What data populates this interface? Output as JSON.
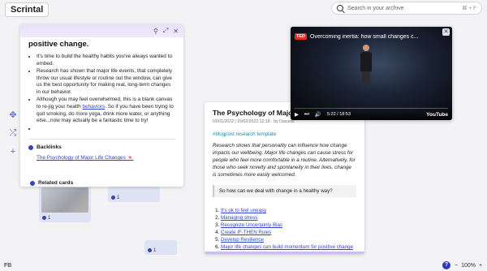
{
  "app": {
    "logo": "Scrintal"
  },
  "search": {
    "placeholder": "Search in your archive",
    "shortcut": "⌘ + F"
  },
  "toolbar_left": {
    "icons": [
      "move-icon",
      "shuffle-icon",
      "plus-icon"
    ]
  },
  "left_card": {
    "title": "positive change.",
    "bullets": [
      "It's time to build the healthy habits you've always wanted to embed.",
      "Research has shown that major life events, that completely throw our usual lifestyle or routine out the window, can give us the best opportunity for making real, long-term changes in our behavior.",
      "Although you may feel overwhelmed, this is a blank canvas to re-jig your health behaviors. So if you have been trying to quit smoking, do more yoga, drink more water, or anything else...now may actually be a fantastic time to try!"
    ],
    "bullet3_parts": {
      "pre": "Although you may feel overwhelmed, this is a blank canvas to re-jig your health ",
      "link": "behaviors",
      "post": ". So if you have been trying to quit smoking, do more yoga, drink more water, or anything else...now may actually be a fantastic time to try!"
    },
    "backlinks_label": "Backlinks",
    "backlink": "The Psychology of Major Life Changes 🍬",
    "related_label": "Related cards"
  },
  "thumb_counts": [
    "1",
    "1",
    "1"
  ],
  "main_card": {
    "title": "The Psychology of Major Life",
    "date": "01/01/2022 | 15/02/2022 12:18 · by Dasuna",
    "tag": "#blogpost research template",
    "paragraph": "Research shows that personality can influence how change impacts our wellbeing. Major life changes can cause stress for people who feel more comfortable in a routine. Alternatively, for those who seek novelty and spontaneity in their lives, change is sometimes more easily welcomed.",
    "quote": "So how can we deal with change in a healthy way?",
    "list": [
      "It's ok to feel uneasy",
      "Managing stress",
      "Recognize Uncertainty Bias",
      "Create IF-THEN Rules",
      "Develop Resilience",
      "Major life changes can build momentum for positive change"
    ]
  },
  "video": {
    "badge": "TED",
    "title": "Overcoming inertia: how small changes c...",
    "time": "5:22 / 18:53",
    "brand": "YouTube",
    "progress": 0.28
  },
  "footer": {
    "left": "FB",
    "help": "?",
    "zoom": "100%",
    "zoom_minus": "−",
    "zoom_plus": "+"
  }
}
